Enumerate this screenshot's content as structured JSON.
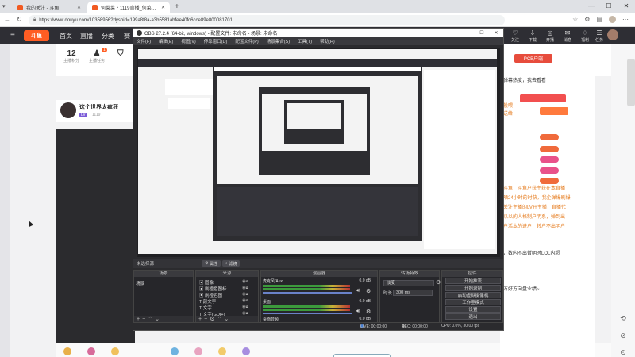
{
  "browser": {
    "tabs": [
      {
        "label": "我的关注 - 斗鱼",
        "active": false
      },
      {
        "label": "何菜菜・1119直播_何菜菜・1119…",
        "active": true
      }
    ],
    "url": "https://www.douyu.com/10358956?dyshid=199a8f8a-a3b5581abfee40fc6cce89e800081701"
  },
  "site": {
    "nav": [
      "首页",
      "直播",
      "分类",
      "赛"
    ],
    "right_nav": [
      "关注",
      "下载",
      "开播",
      "消息",
      "福利",
      "任务"
    ],
    "stats": [
      {
        "value": "12",
        "label": "主播积分"
      },
      {
        "value": "",
        "label": "主播任务"
      }
    ],
    "badge": "1",
    "streamer": {
      "name": "这个世界太疯狂",
      "tag": "LV",
      "sub": "1119"
    },
    "right_panel": {
      "pcb_label": "PCB户端",
      "lines": [
        "弹幕热度，我去看看",
        "投喂",
        "送给"
      ],
      "chat_lines": [
        "斗鱼，斗鱼户获主获在本直播",
        "晒24小时的时获，我企弹爆刷爆",
        "关注主播的LV开主播，直播代",
        "以以的人格制户明系，弹到出",
        "户活本的进户，转户不出明户",
        "，数内不出暂明时LOL内超",
        "方好方向盘业绩~"
      ]
    }
  },
  "obs": {
    "title": "OBS 27.2.4 (64-bit, windows) - 配置文件: 未命名 - 场景: 未命名",
    "menu": [
      "文件(F)",
      "编辑(E)",
      "视图(V)",
      "停靠窗口(D)",
      "配置文件(P)",
      "场景集合(S)",
      "工具(T)",
      "帮助(H)"
    ],
    "source_bar": {
      "selected": "未选择源",
      "properties": "属性",
      "filters": "滤镜"
    },
    "docks": {
      "scenes": {
        "title": "场景",
        "items": [
          "场景"
        ]
      },
      "sources": {
        "title": "来源",
        "items": [
          "图像",
          "刷橙色图标",
          "刷橙色图",
          "颜文字",
          "文字",
          "文字(GDI+)"
        ]
      },
      "mixer": {
        "title": "混音器",
        "channels": [
          {
            "name": "麦克风/Aux",
            "db": "0.0 dB"
          },
          {
            "name": "桌面",
            "db": "0.0 dB"
          },
          {
            "name": "桌面音频",
            "db": "0.0 dB"
          }
        ]
      },
      "transitions": {
        "title": "转场特效",
        "type": "淡变",
        "duration_label": "时长",
        "duration_value": "300 ms"
      },
      "controls": {
        "title": "控件",
        "buttons": [
          "开始推流",
          "开始录制",
          "启动虚拟摄像机",
          "工作室模式",
          "设置",
          "退出"
        ]
      }
    },
    "status": {
      "live": "LIVE: 00:00:00",
      "rec": "REC: 00:00:00",
      "cpu": "CPU: 0.0%, 30.00 fps"
    }
  }
}
